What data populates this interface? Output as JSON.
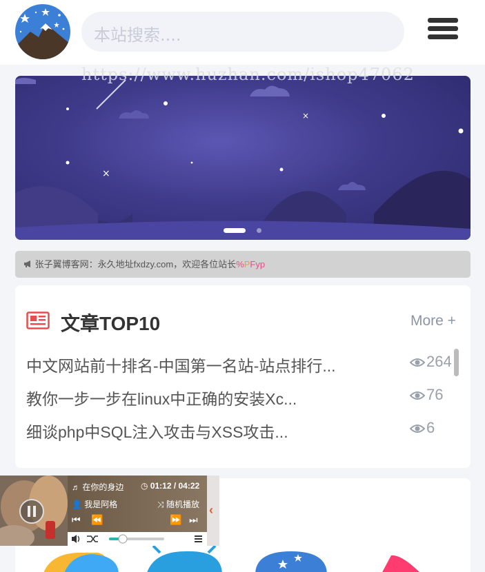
{
  "header": {
    "search_placeholder": "本站搜索....",
    "watermark": "https://www.huzhan.com/ishop47062"
  },
  "notice": {
    "text": "张子翼博客网：永久地址fxdzy.com，欢迎各位站长",
    "suffix1": "%",
    "suffix2": "P",
    "suffix3": "Fyp"
  },
  "top10": {
    "title": "文章TOP10",
    "more": "More +",
    "items": [
      {
        "title": "中文网站前十排名-中国第一名站-站点排行...",
        "views": "264"
      },
      {
        "title": "教你一步一步在linux中正确的安装Xc...",
        "views": "76"
      },
      {
        "title": "细谈php中SQL注入攻击与XSS攻击...",
        "views": "6"
      }
    ]
  },
  "player": {
    "song": "在你的身边",
    "time": "01:12 / 04:22",
    "artist": "我是阿格",
    "mode": "随机播放",
    "progress": 0.25
  },
  "colors": {
    "accent_red": "#e84c4c",
    "banner_bg": "#3f3b8a",
    "handle_arrow": "#e4582c"
  }
}
